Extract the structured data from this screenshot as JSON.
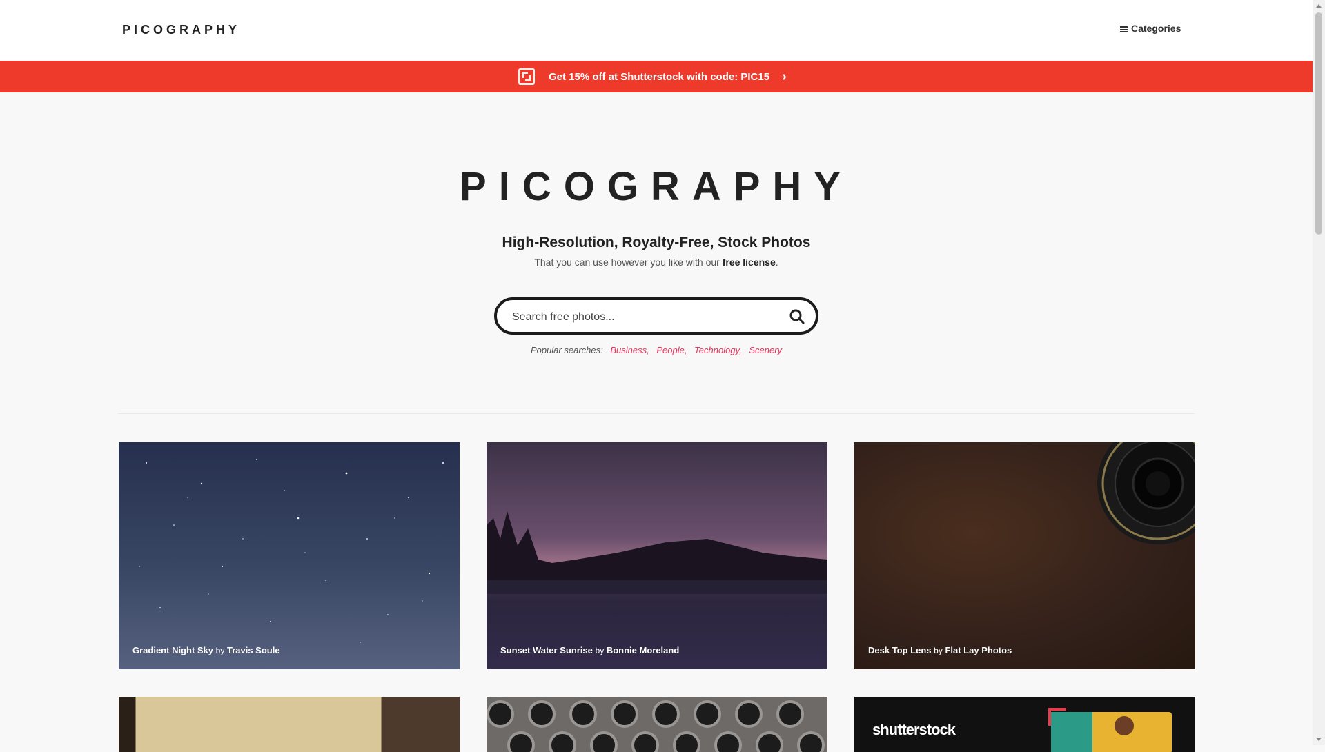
{
  "header": {
    "logo": "PICOGRAPHY",
    "categories_label": "Categories"
  },
  "promo": {
    "text": "Get 15% off at Shutterstock with code: PIC15",
    "icon": "shutterstock-icon",
    "arrow_icon": "chevron-right-icon"
  },
  "hero": {
    "logo": "PICOGRAPHY",
    "title": "High-Resolution, Royalty-Free, Stock Photos",
    "subtitle_prefix": "That you can use however you like with our ",
    "subtitle_link": "free license",
    "subtitle_suffix": "."
  },
  "search": {
    "placeholder": "Search free photos...",
    "value": "",
    "icon": "search-icon"
  },
  "popular": {
    "label": "Popular searches:",
    "tags": [
      "Business,",
      "People,",
      "Technology,",
      "Scenery"
    ]
  },
  "photos": [
    {
      "title": "Gradient Night Sky",
      "by": "by",
      "author": "Travis Soule"
    },
    {
      "title": "Sunset Water Sunrise",
      "by": "by",
      "author": "Bonnie Moreland"
    },
    {
      "title": "Desk Top Lens",
      "by": "by",
      "author": "Flat Lay Photos"
    }
  ],
  "ad": {
    "brand": "shutterstock"
  },
  "colors": {
    "promo_bg": "#ee3a2b",
    "tag_color": "#e8335c",
    "text_dark": "#222222"
  }
}
